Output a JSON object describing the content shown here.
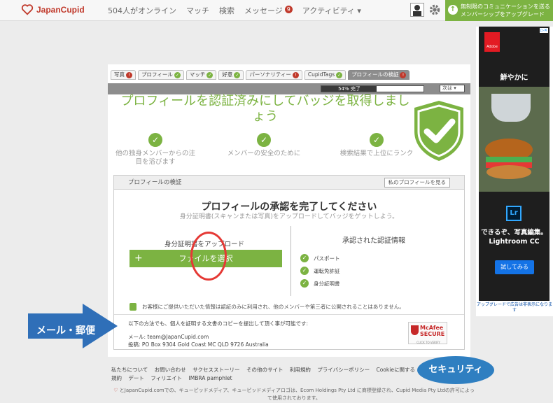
{
  "header": {
    "logo_text": "JapanCupid",
    "nav": [
      "504人がオンライン",
      "マッチ",
      "検索",
      "メッセージ",
      "アクティビティ ▾"
    ],
    "message_badge": "9",
    "upgrade_text": "無制限のコミュニケーションを送るメンバーシップをアップグレード"
  },
  "tabs": [
    {
      "label": "写真",
      "status": "!"
    },
    {
      "label": "プロフィール",
      "status": "✓"
    },
    {
      "label": "マッチ",
      "status": "✓"
    },
    {
      "label": "好意",
      "status": "✓"
    },
    {
      "label": "パーソナリティー",
      "status": "!"
    },
    {
      "label": "CupidTags",
      "status": "✓"
    },
    {
      "label": "プロフィールの検証",
      "status": "!"
    }
  ],
  "progress": {
    "label": "54% 完了",
    "value": 0.54,
    "next": "次は ▾"
  },
  "headline": "プロフィールを認証済みにしてバッジを取得しましょう",
  "benefits": [
    "他の独身メンバーからの注目を浴びます",
    "メンバーの安全のために",
    "検索結果で上位にランク"
  ],
  "panel": {
    "title": "プロフィールの検証",
    "view_button": "私のプロフィールを見る",
    "approve_title": "プロフィールの承認を完了してください",
    "approve_sub": "身分証明書(スキャンまたは写真)をアップロードしてバッジをゲットしよう。",
    "upload_label": "身分証明書をアップロード",
    "upload_button": "ファイルを選択",
    "verified_title": "承認された認証情報",
    "verified_items": [
      "パスポート",
      "運転免許証",
      "身分証明書"
    ],
    "privacy": "お客様にご提供いただいた情報は認証のみに利用され、他のメンバーや第三者に公開されることはありません。",
    "mail_intro": "以下の方法でも、個人を証明する文書のコピーを提出して頂く事が可能です:",
    "mail_email": "メール: team@JapanCupid.com",
    "mail_post": "投稿: PO Box 9304 Gold Coast MC QLD 9726 Australia",
    "mcafee": "McAfee SECURE",
    "mcafee_sub": "CLICK TO VERIFY"
  },
  "footer": {
    "links": [
      "私たちについて",
      "お問い合わせ",
      "サクセスストーリー",
      "その他のサイト",
      "利用規約",
      "プライバシーポリシー",
      "Cookieに関する規約",
      "デート",
      "フィリエイト",
      "IMBRA pamphlet"
    ],
    "copyright": "とJapanCupid.comでの、キューピッドメディア、キューピッドメディアロゴは、Ecom Holdings Pty Ltd に商標登録され、Cupid Media Pty Ltdの許可によって使用されております。"
  },
  "annotations": {
    "mail": "メール・郵便",
    "security": "セキュリティ"
  },
  "ad": {
    "brand": "Adobe",
    "headline": "鮮やかに",
    "product": "Lr",
    "text": "できるぞ、写真編集。Lightroom CC",
    "button": "試してみる",
    "foot": "アップグレードで広告は非表示になります"
  },
  "colors": {
    "accent_green": "#7cb342",
    "alert_red": "#c0392b",
    "annotation_blue": "#2f7fc1"
  }
}
